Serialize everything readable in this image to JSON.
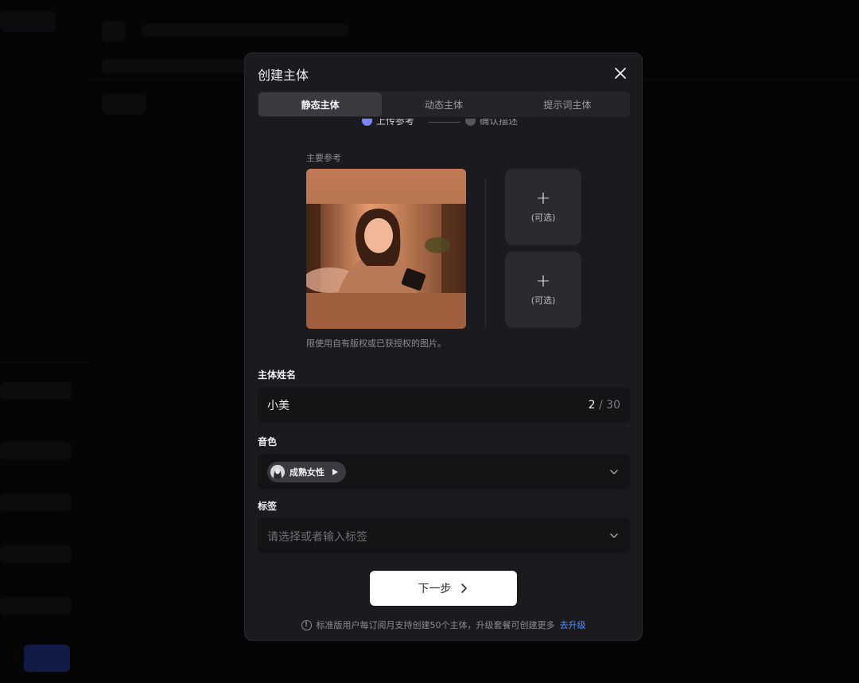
{
  "colors": {
    "accent": "#5b8dff",
    "modal_bg": "#1b1b1f",
    "button_bg": "#ffffff",
    "step_active": "#7a86ff"
  },
  "modal": {
    "title": "创建主体",
    "close_icon": "close-icon",
    "tabs": [
      {
        "label": "静态主体",
        "active": true
      },
      {
        "label": "动态主体",
        "active": false
      },
      {
        "label": "提示词主体",
        "active": false
      }
    ],
    "steps": [
      {
        "label": "上传参考",
        "active": true
      },
      {
        "label": "确认描述",
        "active": false
      }
    ],
    "reference": {
      "label": "主要参考",
      "note": "限使用自有版权或已获授权的图片。",
      "optional_slots": [
        {
          "plus": "+",
          "label": "(可选)"
        },
        {
          "plus": "+",
          "label": "(可选)"
        }
      ]
    },
    "name_field": {
      "label": "主体姓名",
      "value": "小美",
      "count": "2",
      "max": "/ 30"
    },
    "voice_field": {
      "label": "音色",
      "selected": "成熟女性",
      "play_icon": "play-icon",
      "chevron_icon": "chevron-down-icon"
    },
    "tags_field": {
      "label": "标签",
      "placeholder": "请选择或者输入标签",
      "chevron_icon": "chevron-down-icon"
    },
    "next_button": {
      "label": "下一步",
      "icon": "chevron-right-icon"
    },
    "footer": {
      "note": "标准版用户每订阅月支持创建50个主体，升级套餐可创建更多",
      "link": "去升级",
      "icon": "info-icon"
    }
  }
}
